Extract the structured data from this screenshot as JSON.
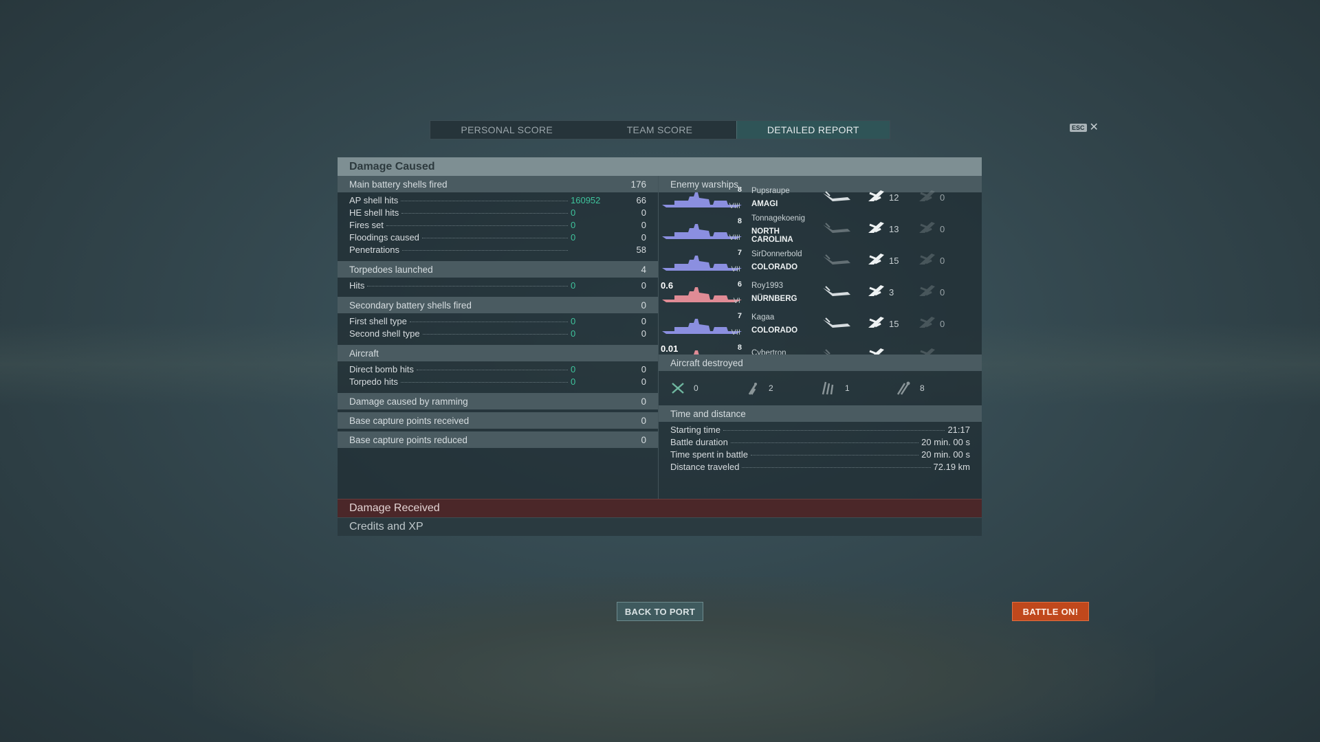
{
  "tabs": [
    "PERSONAL SCORE",
    "TEAM SCORE",
    "DETAILED REPORT"
  ],
  "esc": {
    "key": "ESC",
    "close": "✕"
  },
  "panel_title": "Damage Caused",
  "main_battery": {
    "label": "Main battery shells fired",
    "value": "176",
    "rows": [
      {
        "label": "AP shell hits",
        "damage": "160952",
        "value": "66"
      },
      {
        "label": "HE shell hits",
        "damage": "0",
        "value": "0"
      },
      {
        "label": "Fires set",
        "damage": "0",
        "value": "0"
      },
      {
        "label": "Floodings caused",
        "damage": "0",
        "value": "0"
      },
      {
        "label": "Penetrations",
        "damage": "",
        "value": "58"
      }
    ]
  },
  "torpedoes": {
    "label": "Torpedoes launched",
    "value": "4",
    "rows": [
      {
        "label": "Hits",
        "damage": "0",
        "value": "0"
      }
    ]
  },
  "secondary": {
    "label": "Secondary battery shells fired",
    "value": "0",
    "rows": [
      {
        "label": "First shell type",
        "damage": "0",
        "value": "0"
      },
      {
        "label": "Second shell type",
        "damage": "0",
        "value": "0"
      }
    ]
  },
  "aircraft": {
    "label": "Aircraft",
    "rows": [
      {
        "label": "Direct bomb hits",
        "damage": "0",
        "value": "0"
      },
      {
        "label": "Torpedo hits",
        "damage": "0",
        "value": "0"
      }
    ]
  },
  "ramming": {
    "label": "Damage caused by ramming",
    "value": "0"
  },
  "capture_received": {
    "label": "Base capture points received",
    "value": "0"
  },
  "capture_reduced": {
    "label": "Base capture points reduced",
    "value": "0"
  },
  "enemy_warships": {
    "label": "Enemy warships",
    "ships": [
      {
        "player": "Pupsraupe",
        "ship": "AMAGI",
        "tier": "VIII",
        "cls": "8",
        "color": "#8b8fe0",
        "stat1": "12",
        "stat2": "0",
        "sunk": true,
        "overlay": ""
      },
      {
        "player": "Tonnagekoenig",
        "ship": "NORTH CAROLINA",
        "tier": "VIII",
        "cls": "8",
        "color": "#8b8fe0",
        "stat1": "13",
        "stat2": "0",
        "sunk": false,
        "overlay": ""
      },
      {
        "player": "SirDonnerbold",
        "ship": "COLORADO",
        "tier": "VII",
        "cls": "7",
        "color": "#8b8fe0",
        "stat1": "15",
        "stat2": "0",
        "sunk": false,
        "overlay": ""
      },
      {
        "player": "Roy1993",
        "ship": "NÜRNBERG",
        "tier": "VI",
        "cls": "6",
        "color": "#e08b95",
        "stat1": "3",
        "stat2": "0",
        "sunk": true,
        "overlay": "0.6"
      },
      {
        "player": "Kagaa",
        "ship": "COLORADO",
        "tier": "VII",
        "cls": "7",
        "color": "#8b8fe0",
        "stat1": "15",
        "stat2": "0",
        "sunk": true,
        "overlay": ""
      },
      {
        "player": "Cybertron",
        "ship": "",
        "tier": "",
        "cls": "8",
        "color": "#e08b95",
        "stat1": "",
        "stat2": "",
        "sunk": false,
        "overlay": "0.01"
      }
    ]
  },
  "aircraft_destroyed": {
    "label": "Aircraft destroyed",
    "values": [
      "0",
      "2",
      "1",
      "8"
    ]
  },
  "time_distance": {
    "label": "Time and distance",
    "rows": [
      {
        "label": "Starting time",
        "value": "21:17"
      },
      {
        "label": "Battle duration",
        "value": "20 min. 00 s"
      },
      {
        "label": "Time spent in battle",
        "value": "20 min. 00 s"
      },
      {
        "label": "Distance traveled",
        "value": "72.19 km"
      }
    ]
  },
  "damage_received": "Damage Received",
  "credits_xp": "Credits and XP",
  "buttons": {
    "back": "BACK TO PORT",
    "battle": "BATTLE ON!"
  },
  "colors": {
    "accent_green": "#3fc39c",
    "battle_button": "#c0481c",
    "ally_ship": "#8b8fe0",
    "enemy_ship": "#e08b95"
  }
}
